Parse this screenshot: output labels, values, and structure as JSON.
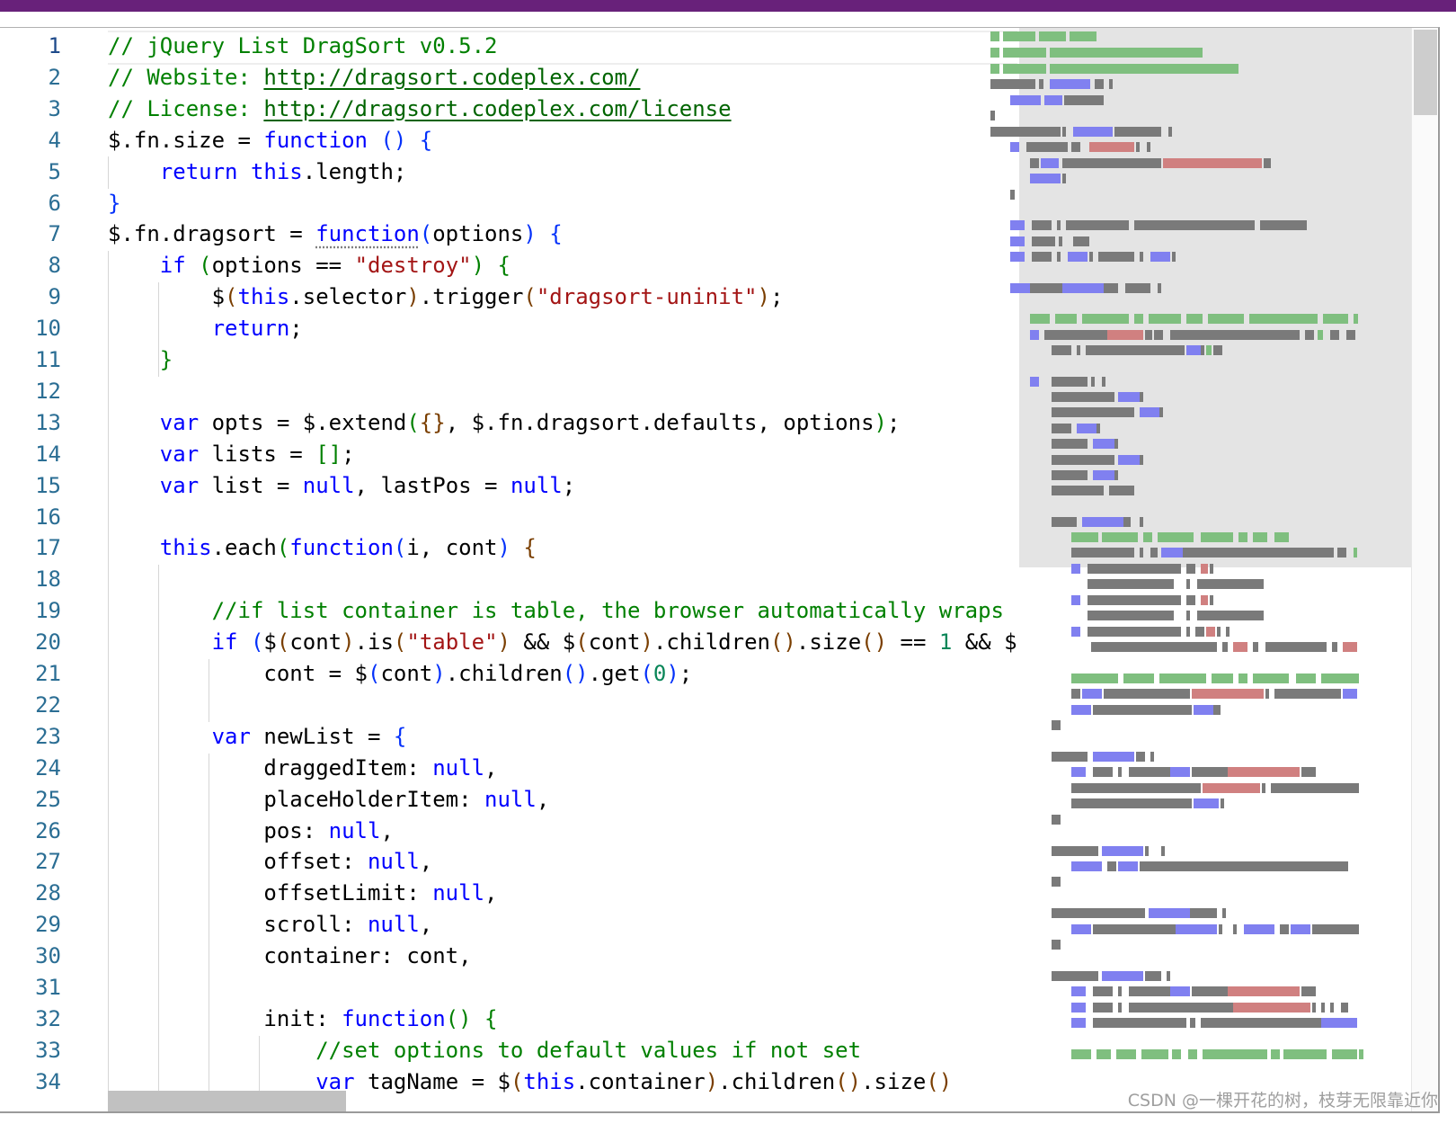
{
  "editor": {
    "language": "javascript",
    "current_line": 1,
    "lines": [
      {
        "n": 1,
        "tokens": [
          [
            "c",
            "// jQuery List DragSort v0.5.2"
          ]
        ]
      },
      {
        "n": 2,
        "tokens": [
          [
            "c",
            "// Website: "
          ],
          [
            "u",
            "http://dragsort.codeplex.com/"
          ]
        ]
      },
      {
        "n": 3,
        "tokens": [
          [
            "c",
            "// License: "
          ],
          [
            "u",
            "http://dragsort.codeplex.com/license"
          ]
        ]
      },
      {
        "n": 4,
        "tokens": [
          [
            "t",
            "$.fn.size = "
          ],
          [
            "k",
            "function"
          ],
          [
            "t",
            " "
          ],
          [
            "p2",
            "()"
          ],
          [
            "t",
            " "
          ],
          [
            "p2",
            "{"
          ]
        ]
      },
      {
        "n": 5,
        "tokens": [
          [
            "t",
            "    "
          ],
          [
            "k",
            "return"
          ],
          [
            "t",
            " "
          ],
          [
            "k",
            "this"
          ],
          [
            "t",
            ".length;"
          ]
        ]
      },
      {
        "n": 6,
        "tokens": [
          [
            "p2",
            "}"
          ]
        ]
      },
      {
        "n": 7,
        "tokens": [
          [
            "t",
            "$.fn.dragsort = "
          ],
          [
            "kd",
            "function"
          ],
          [
            "p2",
            "("
          ],
          [
            "t",
            "options"
          ],
          [
            "p2",
            ")"
          ],
          [
            "t",
            " "
          ],
          [
            "p2",
            "{"
          ]
        ]
      },
      {
        "n": 8,
        "tokens": [
          [
            "t",
            "    "
          ],
          [
            "k",
            "if"
          ],
          [
            "t",
            " "
          ],
          [
            "p3",
            "("
          ],
          [
            "t",
            "options == "
          ],
          [
            "s",
            "\"destroy\""
          ],
          [
            "p3",
            ")"
          ],
          [
            "t",
            " "
          ],
          [
            "p3",
            "{"
          ]
        ]
      },
      {
        "n": 9,
        "tokens": [
          [
            "t",
            "        $"
          ],
          [
            "p1",
            "("
          ],
          [
            "k",
            "this"
          ],
          [
            "t",
            ".selector"
          ],
          [
            "p1",
            ")"
          ],
          [
            "t",
            ".trigger"
          ],
          [
            "p1",
            "("
          ],
          [
            "s",
            "\"dragsort-uninit\""
          ],
          [
            "p1",
            ")"
          ],
          [
            "t",
            ";"
          ]
        ]
      },
      {
        "n": 10,
        "tokens": [
          [
            "t",
            "        "
          ],
          [
            "k",
            "return"
          ],
          [
            "t",
            ";"
          ]
        ]
      },
      {
        "n": 11,
        "tokens": [
          [
            "t",
            "    "
          ],
          [
            "p3",
            "}"
          ]
        ]
      },
      {
        "n": 12,
        "tokens": []
      },
      {
        "n": 13,
        "tokens": [
          [
            "t",
            "    "
          ],
          [
            "k",
            "var"
          ],
          [
            "t",
            " opts = $.extend"
          ],
          [
            "p3",
            "("
          ],
          [
            "p1",
            "{}"
          ],
          [
            "t",
            ", $.fn.dragsort.defaults, options"
          ],
          [
            "p3",
            ")"
          ],
          [
            "t",
            ";"
          ]
        ]
      },
      {
        "n": 14,
        "tokens": [
          [
            "t",
            "    "
          ],
          [
            "k",
            "var"
          ],
          [
            "t",
            " lists = "
          ],
          [
            "p3",
            "[]"
          ],
          [
            "t",
            ";"
          ]
        ]
      },
      {
        "n": 15,
        "tokens": [
          [
            "t",
            "    "
          ],
          [
            "k",
            "var"
          ],
          [
            "t",
            " list = "
          ],
          [
            "k",
            "null"
          ],
          [
            "t",
            ", lastPos = "
          ],
          [
            "k",
            "null"
          ],
          [
            "t",
            ";"
          ]
        ]
      },
      {
        "n": 16,
        "tokens": []
      },
      {
        "n": 17,
        "tokens": [
          [
            "t",
            "    "
          ],
          [
            "k",
            "this"
          ],
          [
            "t",
            ".each"
          ],
          [
            "p3",
            "("
          ],
          [
            "k",
            "function"
          ],
          [
            "p2",
            "("
          ],
          [
            "t",
            "i, cont"
          ],
          [
            "p2",
            ")"
          ],
          [
            "t",
            " "
          ],
          [
            "p1",
            "{"
          ]
        ]
      },
      {
        "n": 18,
        "tokens": []
      },
      {
        "n": 19,
        "tokens": [
          [
            "t",
            "        "
          ],
          [
            "c",
            "//if list container is table, the browser automatically wraps"
          ]
        ]
      },
      {
        "n": 20,
        "tokens": [
          [
            "t",
            "        "
          ],
          [
            "k",
            "if"
          ],
          [
            "t",
            " "
          ],
          [
            "p2",
            "("
          ],
          [
            "t",
            "$"
          ],
          [
            "p1",
            "("
          ],
          [
            "t",
            "cont"
          ],
          [
            "p1",
            ")"
          ],
          [
            "t",
            ".is"
          ],
          [
            "p1",
            "("
          ],
          [
            "s",
            "\"table\""
          ],
          [
            "p1",
            ")"
          ],
          [
            "t",
            " && $"
          ],
          [
            "p1",
            "("
          ],
          [
            "t",
            "cont"
          ],
          [
            "p1",
            ")"
          ],
          [
            "t",
            ".children"
          ],
          [
            "p1",
            "()"
          ],
          [
            "t",
            ".size"
          ],
          [
            "p1",
            "()"
          ],
          [
            "t",
            " == "
          ],
          [
            "n",
            "1"
          ],
          [
            "t",
            " && $"
          ]
        ]
      },
      {
        "n": 21,
        "tokens": [
          [
            "t",
            "            cont = $"
          ],
          [
            "p2",
            "("
          ],
          [
            "t",
            "cont"
          ],
          [
            "p2",
            ")"
          ],
          [
            "t",
            ".children"
          ],
          [
            "p2",
            "()"
          ],
          [
            "t",
            ".get"
          ],
          [
            "p2",
            "("
          ],
          [
            "n",
            "0"
          ],
          [
            "p2",
            ")"
          ],
          [
            "t",
            ";"
          ]
        ]
      },
      {
        "n": 22,
        "tokens": []
      },
      {
        "n": 23,
        "tokens": [
          [
            "t",
            "        "
          ],
          [
            "k",
            "var"
          ],
          [
            "t",
            " newList = "
          ],
          [
            "p2",
            "{"
          ]
        ]
      },
      {
        "n": 24,
        "tokens": [
          [
            "t",
            "            draggedItem: "
          ],
          [
            "k",
            "null"
          ],
          [
            "t",
            ","
          ]
        ]
      },
      {
        "n": 25,
        "tokens": [
          [
            "t",
            "            placeHolderItem: "
          ],
          [
            "k",
            "null"
          ],
          [
            "t",
            ","
          ]
        ]
      },
      {
        "n": 26,
        "tokens": [
          [
            "t",
            "            pos: "
          ],
          [
            "k",
            "null"
          ],
          [
            "t",
            ","
          ]
        ]
      },
      {
        "n": 27,
        "tokens": [
          [
            "t",
            "            offset: "
          ],
          [
            "k",
            "null"
          ],
          [
            "t",
            ","
          ]
        ]
      },
      {
        "n": 28,
        "tokens": [
          [
            "t",
            "            offsetLimit: "
          ],
          [
            "k",
            "null"
          ],
          [
            "t",
            ","
          ]
        ]
      },
      {
        "n": 29,
        "tokens": [
          [
            "t",
            "            scroll: "
          ],
          [
            "k",
            "null"
          ],
          [
            "t",
            ","
          ]
        ]
      },
      {
        "n": 30,
        "tokens": [
          [
            "t",
            "            container: cont,"
          ]
        ]
      },
      {
        "n": 31,
        "tokens": []
      },
      {
        "n": 32,
        "tokens": [
          [
            "t",
            "            init: "
          ],
          [
            "k",
            "function"
          ],
          [
            "p3",
            "()"
          ],
          [
            "t",
            " "
          ],
          [
            "p3",
            "{"
          ]
        ]
      },
      {
        "n": 33,
        "tokens": [
          [
            "t",
            "                "
          ],
          [
            "c",
            "//set options to default values if not set"
          ]
        ]
      },
      {
        "n": 34,
        "tokens": [
          [
            "t",
            "                "
          ],
          [
            "k",
            "var"
          ],
          [
            "t",
            " tagName = $"
          ],
          [
            "p1",
            "("
          ],
          [
            "k",
            "this"
          ],
          [
            "t",
            ".container"
          ],
          [
            "p1",
            ")"
          ],
          [
            "t",
            ".children"
          ],
          [
            "p1",
            "()"
          ],
          [
            "t",
            ".size"
          ],
          [
            "p1",
            "()"
          ]
        ]
      }
    ]
  },
  "colors": {
    "keyword": "#0000ff",
    "string": "#a31515",
    "comment": "#008000",
    "number": "#098658",
    "line_number": "#2b6e94",
    "title_bar": "#68217a"
  },
  "watermark": "CSDN @一棵开花的树，枝芽无限靠近你"
}
